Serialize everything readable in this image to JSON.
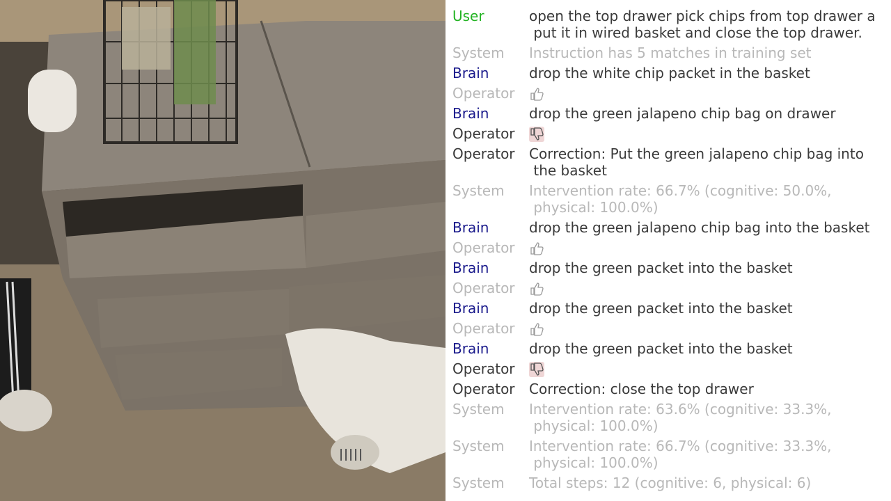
{
  "camera": {
    "description_icon": "robot-camera-view"
  },
  "log": [
    {
      "role": "User",
      "text": "open the top drawer pick chips from top drawer a\n put it in wired basket and close the top drawer."
    },
    {
      "role": "System",
      "text": "Instruction has 5 matches in training set"
    },
    {
      "role": "Brain",
      "text": "drop the white chip packet in the basket"
    },
    {
      "role": "Operator",
      "icon": "thumbs-up-icon"
    },
    {
      "role": "Brain",
      "text": "drop the green jalapeno chip bag on drawer"
    },
    {
      "role": "Operator",
      "icon": "thumbs-down-icon"
    },
    {
      "role": "Operator",
      "text": "Correction: Put the green jalapeno chip bag into\n the basket"
    },
    {
      "role": "System",
      "text": "Intervention rate: 66.7% (cognitive: 50.0%,\n physical: 100.0%)"
    },
    {
      "role": "Brain",
      "text": "drop the green jalapeno chip bag into the basket"
    },
    {
      "role": "Operator",
      "icon": "thumbs-up-icon"
    },
    {
      "role": "Brain",
      "text": "drop the green packet into the basket"
    },
    {
      "role": "Operator",
      "icon": "thumbs-up-icon"
    },
    {
      "role": "Brain",
      "text": "drop the green packet into the basket"
    },
    {
      "role": "Operator",
      "icon": "thumbs-up-icon"
    },
    {
      "role": "Brain",
      "text": "drop the green packet into the basket"
    },
    {
      "role": "Operator",
      "icon": "thumbs-down-icon"
    },
    {
      "role": "Operator",
      "text": "Correction: close the top drawer"
    },
    {
      "role": "System",
      "text": "Intervention rate: 63.6% (cognitive: 33.3%,\n physical: 100.0%)"
    },
    {
      "role": "System",
      "text": "Intervention rate: 66.7% (cognitive: 33.3%,\n physical: 100.0%)"
    },
    {
      "role": "System",
      "text": "Total steps: 12 (cognitive: 6, physical: 6)"
    }
  ]
}
